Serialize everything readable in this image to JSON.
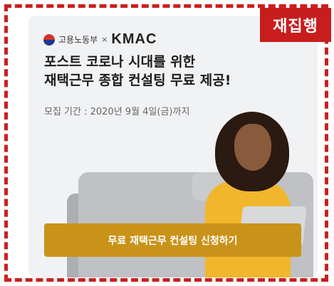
{
  "badge": {
    "label": "재집행"
  },
  "header": {
    "gov_name": "고용노동부",
    "separator": "×",
    "partner": "KMAC"
  },
  "headline": {
    "line1": "포스트 코로나 시대를 위한",
    "line2": "재택근무 종합 컨설팅 무료 제공!"
  },
  "period": {
    "text": "모집 기간 : 2020년 9월 4일(금)까지"
  },
  "cta": {
    "label": "무료 재택근무 컨설팅 신청하기"
  },
  "colors": {
    "frame": "#cc1f1f",
    "badge": "#c81d1d",
    "cta": "#c9931a",
    "card": "#f1f2f4"
  }
}
